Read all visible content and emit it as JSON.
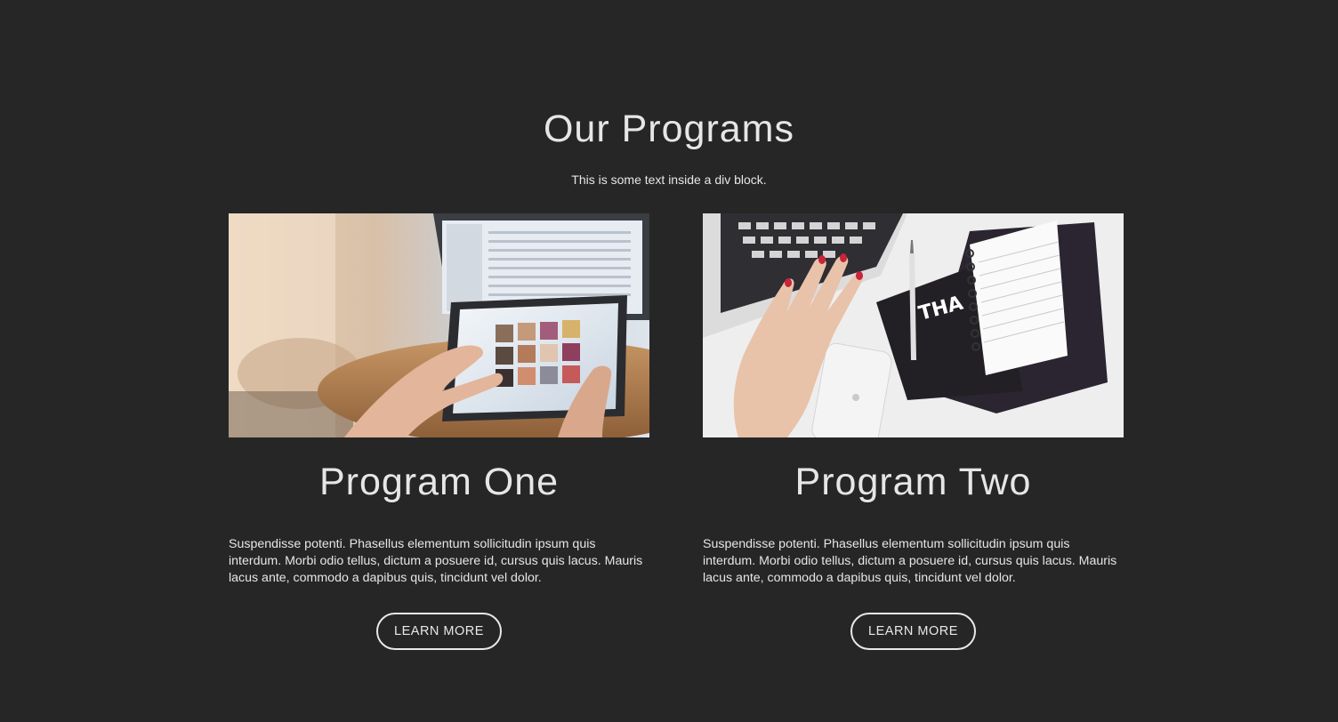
{
  "section": {
    "title": "Our Programs",
    "subtitle": "This is some text inside a div block."
  },
  "programs": [
    {
      "title": "Program One",
      "description": "Suspendisse potenti. Phasellus elementum sollicitudin ipsum quis interdum. Morbi odio tellus, dictum a posuere id, cursus quis lacus. Mauris lacus ante, commodo a dapibus quis, tincidunt vel dolor.",
      "button_label": "LEARN MORE",
      "image": "hands-using-tablet-photo"
    },
    {
      "title": "Program Two",
      "description": "Suspendisse potenti. Phasellus elementum sollicitudin ipsum quis interdum. Morbi odio tellus, dictum a posuere id, cursus quis lacus. Mauris lacus ante, commodo a dapibus quis, tincidunt vel dolor.",
      "button_label": "LEARN MORE",
      "image": "laptop-notebook-desk-photo"
    }
  ],
  "colors": {
    "background": "#262626",
    "text": "#e6e6e6",
    "button_border": "#e8e8e8"
  }
}
